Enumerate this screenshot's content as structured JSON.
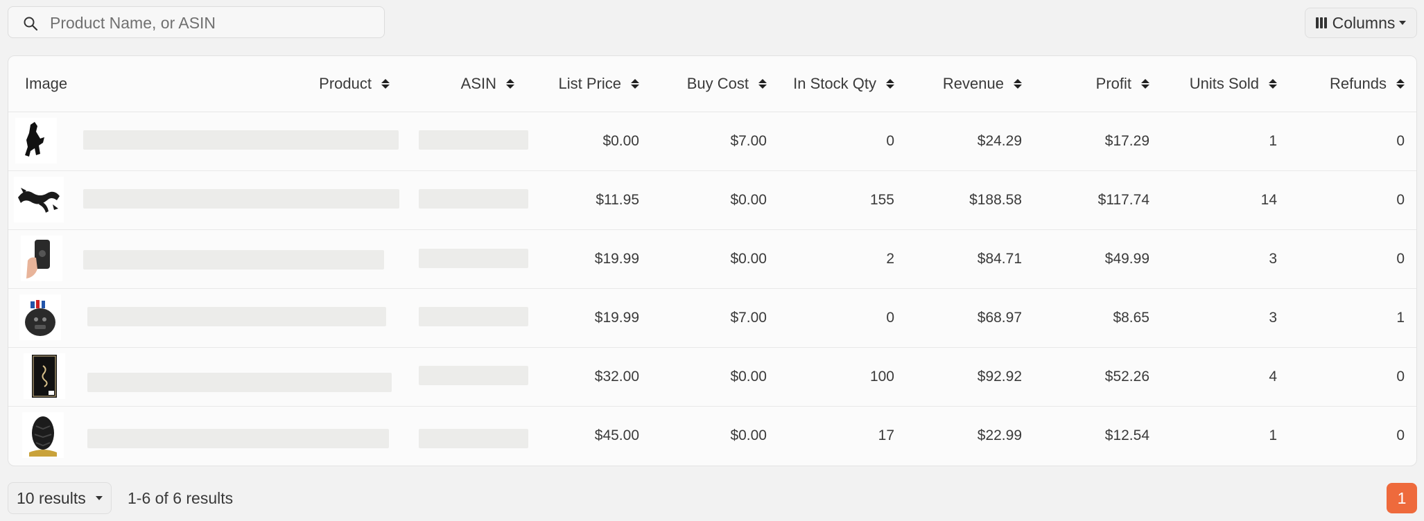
{
  "search": {
    "placeholder": "Product Name, or ASIN"
  },
  "toolbar": {
    "columns_label": "Columns"
  },
  "table": {
    "headers": {
      "image": "Image",
      "product": "Product",
      "asin": "ASIN",
      "list_price": "List Price",
      "buy_cost": "Buy Cost",
      "in_stock": "In Stock Qty",
      "revenue": "Revenue",
      "profit": "Profit",
      "units_sold": "Units Sold",
      "refunds": "Refunds"
    },
    "rows": [
      {
        "thumbnail": "black-dragon-figure",
        "list_price": "$0.00",
        "buy_cost": "$7.00",
        "in_stock": "0",
        "revenue": "$24.29",
        "profit": "$17.29",
        "units_sold": "1",
        "refunds": "0"
      },
      {
        "thumbnail": "articulated-dragon",
        "list_price": "$11.95",
        "buy_cost": "$0.00",
        "in_stock": "155",
        "revenue": "$188.58",
        "profit": "$117.74",
        "units_sold": "14",
        "refunds": "0"
      },
      {
        "thumbnail": "phone-case-in-hand",
        "list_price": "$19.99",
        "buy_cost": "$0.00",
        "in_stock": "2",
        "revenue": "$84.71",
        "profit": "$49.99",
        "units_sold": "3",
        "refunds": "0"
      },
      {
        "thumbnail": "gorilla-pen-holder",
        "list_price": "$19.99",
        "buy_cost": "$7.00",
        "in_stock": "0",
        "revenue": "$68.97",
        "profit": "$8.65",
        "units_sold": "3",
        "refunds": "1"
      },
      {
        "thumbnail": "black-book-gold-dragon",
        "list_price": "$32.00",
        "buy_cost": "$0.00",
        "in_stock": "100",
        "revenue": "$92.92",
        "profit": "$52.26",
        "units_sold": "4",
        "refunds": "0"
      },
      {
        "thumbnail": "black-dragon-egg",
        "list_price": "$45.00",
        "buy_cost": "$0.00",
        "in_stock": "17",
        "revenue": "$22.99",
        "profit": "$12.54",
        "units_sold": "1",
        "refunds": "0"
      }
    ]
  },
  "footer": {
    "per_page": "10 results",
    "range": "1-6 of 6 results",
    "current_page": "1"
  },
  "colors": {
    "accent": "#ee6a3c",
    "background": "#f2f2f2",
    "placeholder_bar": "#ececea"
  }
}
